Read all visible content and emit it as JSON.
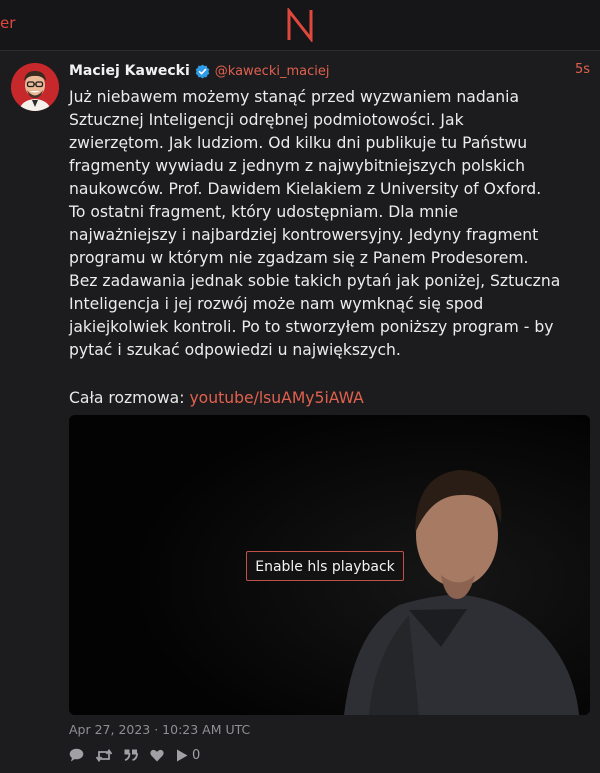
{
  "topbar": {
    "edge_fragment": "er",
    "logo_letter": "N"
  },
  "post": {
    "author_name": "Maciej Kawecki",
    "handle": "@kawecki_maciej",
    "relative_time": "5s",
    "body": "Już niebawem możemy stanąć przed wyzwaniem nadania\nSztucznej Inteligencji odrębnej podmiotowości. Jak\nzwierzętom. Jak ludziom. Od kilku dni publikuje tu Państwu\nfragmenty wywiadu z jednym z najwybitniejszych polskich\nnaukowców. Prof. Dawidem Kielakiem z University of Oxford.\nTo ostatni fragment, który udostępniam. Dla mnie\nnajważniejszy i najbardziej kontrowersyjny. Jedyny fragment\nprogramu w którym nie zgadzam się z Panem Prodesorem.\nBez zadawania jednak sobie takich pytań jak poniżej, Sztuczna\nInteligencja i jej rozwój może nam wymknąć się spod\njakiejkolwiek kontroli. Po to stworzyłem poniższy program - by\npytać i szukać odpowiedzi u największych.",
    "link_prefix": "Cała rozmowa: ",
    "link_text": "youtube/lsuAMy5iAWA",
    "video_button": "Enable hls playback",
    "date": "Apr 27, 2023 · 10:23 AM UTC",
    "play_count": "0"
  },
  "icons": [
    "n-logo-icon",
    "verified-badge-icon",
    "reply-icon",
    "retweet-icon",
    "quote-icon",
    "like-icon",
    "play-icon"
  ],
  "colors": {
    "background": "#1c1c1e",
    "accent": "#e0604e",
    "muted": "#8f8f94"
  }
}
